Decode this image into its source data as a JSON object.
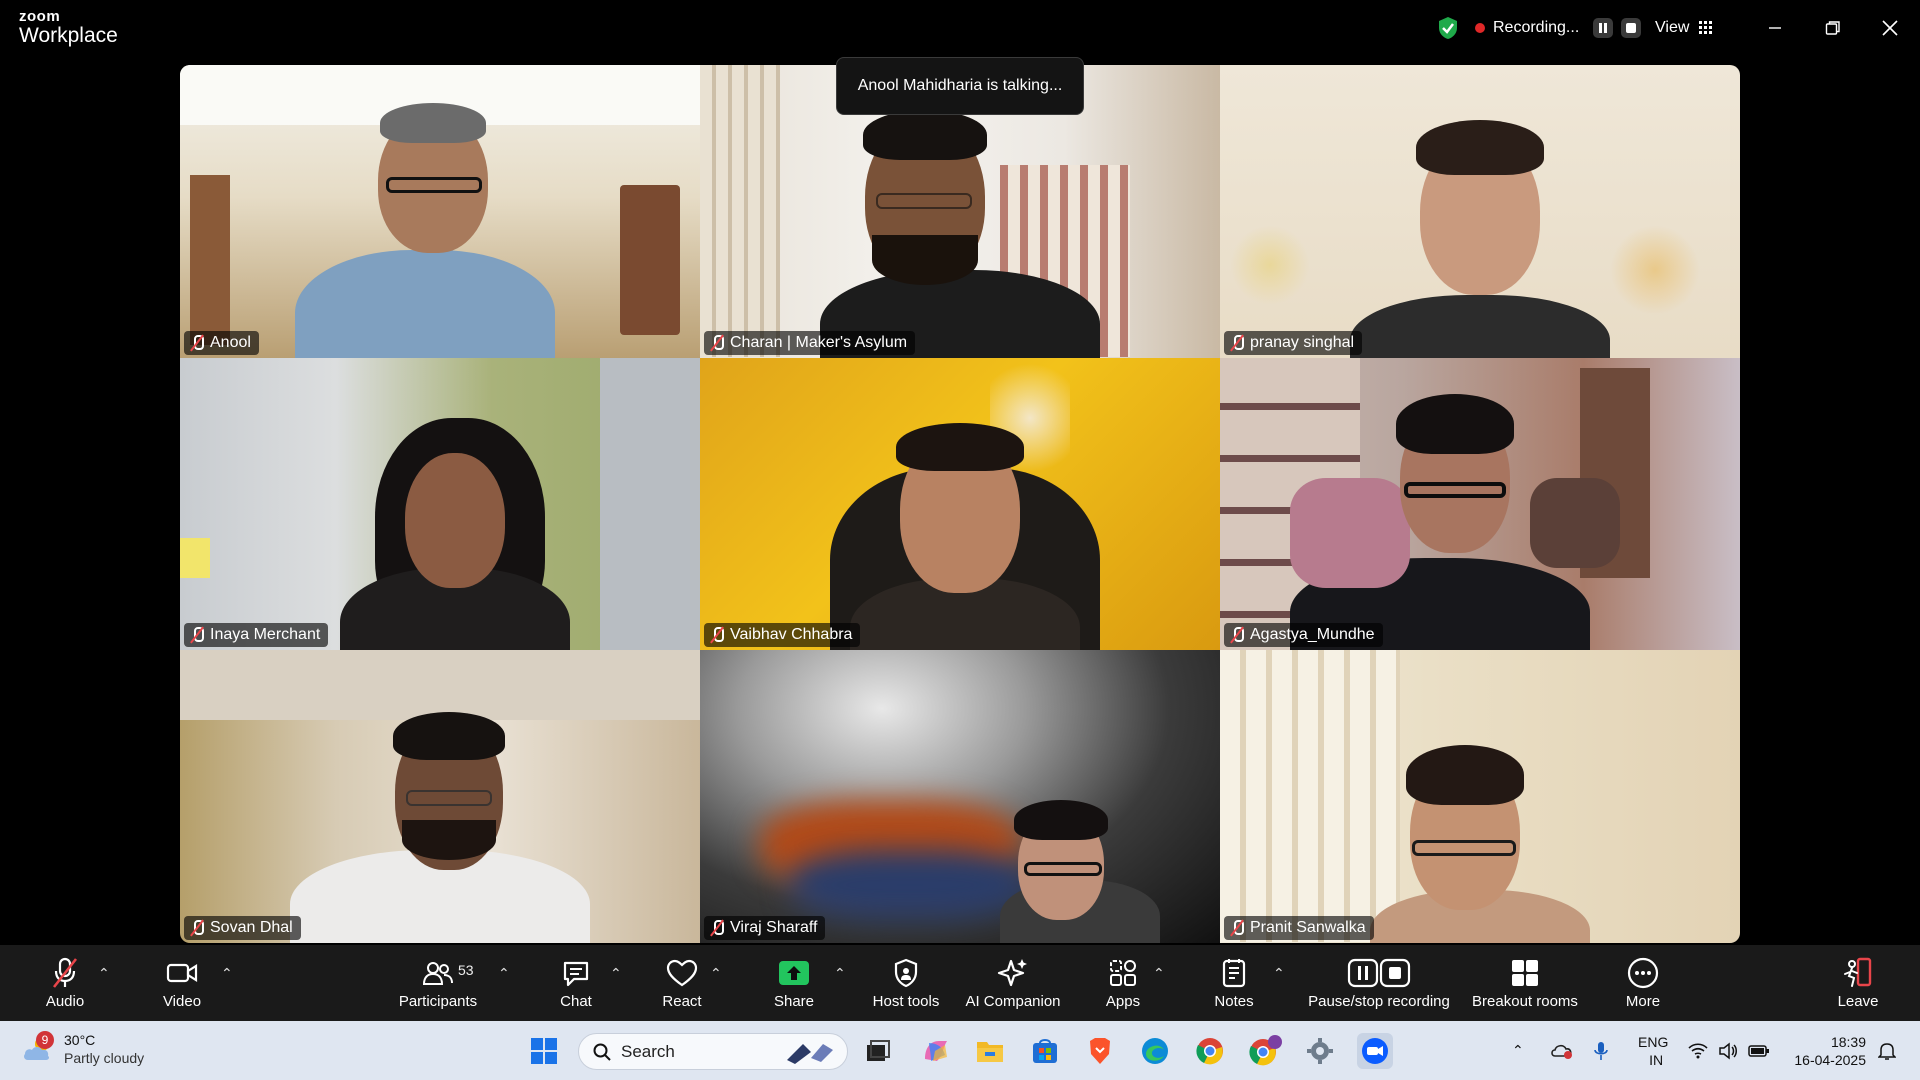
{
  "app": {
    "brand_top": "zoom",
    "brand_bottom": "Workplace"
  },
  "titlebar": {
    "recording_label": "Recording...",
    "view_label": "View"
  },
  "speaking_indicator": "Anool Mahidharia is talking...",
  "participants": [
    {
      "name": "Anool",
      "muted": true
    },
    {
      "name": "Charan | Maker's Asylum",
      "muted": true
    },
    {
      "name": "pranay singhal",
      "muted": true
    },
    {
      "name": "Inaya Merchant",
      "muted": true
    },
    {
      "name": "Vaibhav Chhabra",
      "muted": true
    },
    {
      "name": "Agastya_Mundhe",
      "muted": true
    },
    {
      "name": "Sovan Dhal",
      "muted": true
    },
    {
      "name": "Viraj Sharaff",
      "muted": true
    },
    {
      "name": "Pranit Sanwalka",
      "muted": true
    }
  ],
  "toolbar": {
    "audio": "Audio",
    "video": "Video",
    "participants": "Participants",
    "participants_count": "53",
    "chat": "Chat",
    "react": "React",
    "share": "Share",
    "host_tools": "Host tools",
    "ai_companion": "AI Companion",
    "apps": "Apps",
    "notes": "Notes",
    "pause_stop_recording": "Pause/stop recording",
    "breakout_rooms": "Breakout rooms",
    "more": "More",
    "leave": "Leave"
  },
  "taskbar": {
    "weather_badge": "9",
    "temperature": "30°C",
    "condition": "Partly cloudy",
    "search_placeholder": "Search",
    "language_top": "ENG",
    "language_bottom": "IN",
    "time": "18:39",
    "date": "16-04-2025"
  },
  "colors": {
    "share_green": "#22c55e",
    "recording_red": "#e02828",
    "mute_red": "#e8454a",
    "leave_red": "#e8454a",
    "taskbar_bg": "#dfe6f1"
  }
}
